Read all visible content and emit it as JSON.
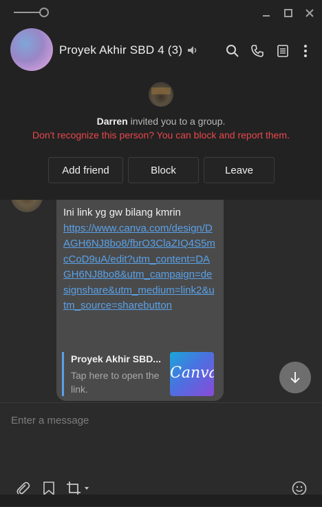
{
  "window": {
    "pin_icon": "pin-slider-icon",
    "controls": [
      "minimize-icon",
      "maximize-icon",
      "close-icon"
    ]
  },
  "header": {
    "title": "Proyek Akhir SBD 4 (3)",
    "icons": [
      "speaker-icon",
      "search-icon",
      "phone-icon",
      "notes-icon",
      "more-vertical-icon"
    ]
  },
  "notice": {
    "inviter": "Darren",
    "invite_text": "invited you to a group.",
    "warning": "Don't recognize this person? You can block and report them.",
    "buttons": {
      "add_friend": "Add friend",
      "block": "Block",
      "leave": "Leave"
    }
  },
  "message": {
    "text": "Ini link yg gw bilang kmrin",
    "link": "https://www.canva.com/design/DAGH6NJ8bo8/fbrO3ClaZIQ4S5mcCoD9uA/edit?utm_content=DAGH6NJ8bo8&utm_campaign=designshare&utm_medium=link2&utm_source=sharebutton",
    "preview": {
      "title": "Proyek Akhir SBD...",
      "description": "Tap here to open the link.",
      "thumbnail_text": "Canva"
    }
  },
  "input": {
    "placeholder": "Enter a message"
  },
  "toolbar": {
    "icons": [
      "attachment-icon",
      "bookmark-icon",
      "crop-icon",
      "emoji-icon"
    ]
  },
  "colors": {
    "warning": "#e9484d",
    "link": "#5aa1e8",
    "background": "#2b2b2b"
  }
}
